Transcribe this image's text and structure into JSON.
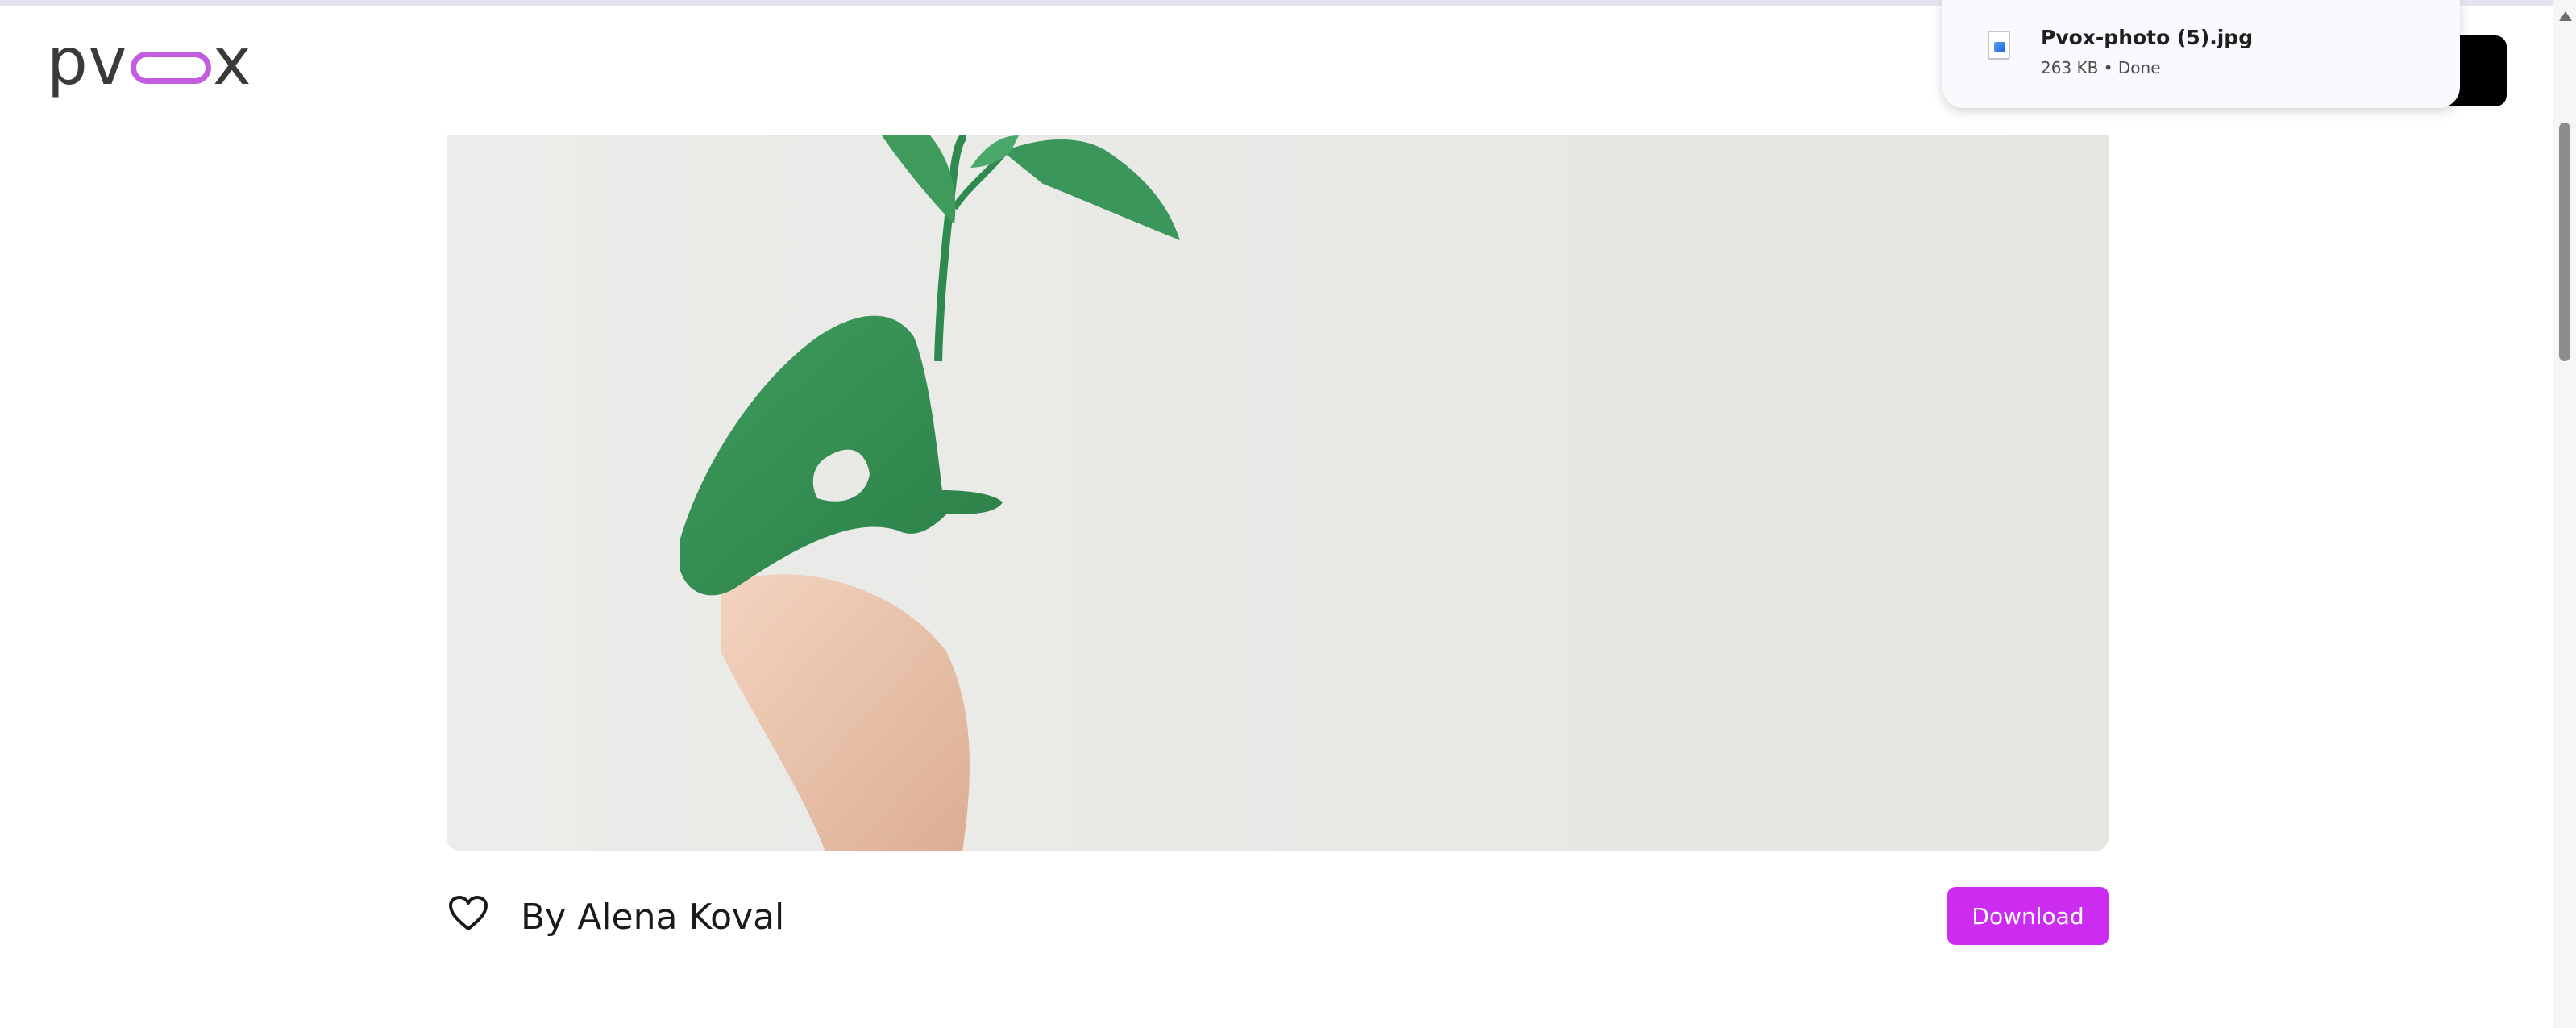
{
  "header": {
    "logo_left": "pv",
    "logo_right": "x"
  },
  "download_popup": {
    "file_name": "Pvox-photo (5).jpg",
    "file_meta": "263 KB • Done",
    "icon": "image-file-icon"
  },
  "photo": {
    "alt": "Hand painted green holding a small plant sprig",
    "author": "By Alena Koval",
    "download_label": "Download"
  },
  "colors": {
    "brand_accent": "#cc2cf0",
    "logo_pill": "#c25ce0",
    "logo_text": "#3a3a3a"
  }
}
